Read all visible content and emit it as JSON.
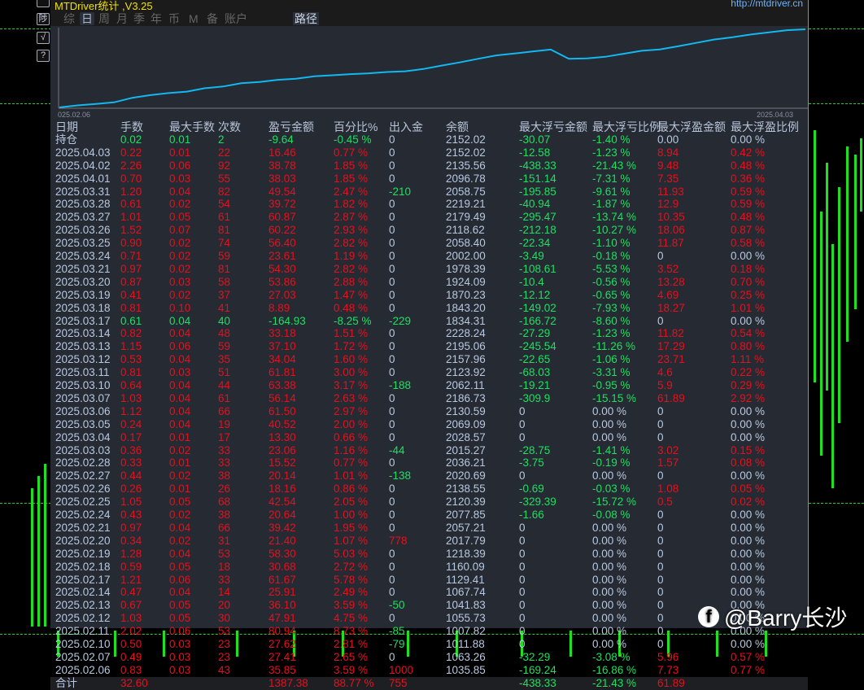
{
  "window": {
    "title": "MTDriver统计 ,V3.25",
    "url": "http://mtdriver.cn"
  },
  "toolbar": {
    "buttons": [
      "",
      "陟",
      "√",
      "?"
    ]
  },
  "tabs": [
    {
      "label": "综"
    },
    {
      "label": "日",
      "active": true
    },
    {
      "label": "周"
    },
    {
      "label": "月"
    },
    {
      "label": "季"
    },
    {
      "label": "年"
    },
    {
      "label": "币"
    },
    {
      "label": "M"
    },
    {
      "label": "备"
    },
    {
      "label": "账户"
    },
    {
      "label": "路径"
    }
  ],
  "chart_data": {
    "type": "line",
    "x_start_label": "025.02.06",
    "x_end_label": "2025.04.03",
    "series": "cumulative profit from table rows",
    "color": "#12b8f0"
  },
  "table": {
    "headers": [
      "日期",
      "手数",
      "最大手数",
      "次数",
      "盈亏金额",
      "百分比%",
      "出入金",
      "余额",
      "最大浮亏金额",
      "最大浮亏比例",
      "最大浮盈金额",
      "最大浮盈比例"
    ],
    "holding": [
      "持仓",
      "0.02",
      "0.01",
      "2",
      "-9.64",
      "-0.45 %",
      "0",
      "2152.02",
      "-30.07",
      "-1.40 %",
      "0.00",
      "0.00 %"
    ],
    "rows": [
      [
        "2025.04.03",
        "0.22",
        "0.01",
        "22",
        "16.46",
        "0.77 %",
        "0",
        "2152.02",
        "-12.58",
        "-1.23 %",
        "8.94",
        "0.42 %"
      ],
      [
        "2025.04.02",
        "2.26",
        "0.06",
        "92",
        "38.78",
        "1.85 %",
        "0",
        "2135.56",
        "-438.33",
        "-21.43 %",
        "9.48",
        "0.48 %"
      ],
      [
        "2025.04.01",
        "0.70",
        "0.03",
        "55",
        "38.03",
        "1.85 %",
        "0",
        "2096.78",
        "-151.14",
        "-7.31 %",
        "7.35",
        "0.36 %"
      ],
      [
        "2025.03.31",
        "1.20",
        "0.04",
        "82",
        "49.54",
        "2.47 %",
        "-210",
        "2058.75",
        "-195.85",
        "-9.61 %",
        "11.93",
        "0.59 %"
      ],
      [
        "2025.03.28",
        "0.61",
        "0.02",
        "54",
        "39.72",
        "1.82 %",
        "0",
        "2219.21",
        "-40.94",
        "-1.87 %",
        "12.9",
        "0.59 %"
      ],
      [
        "2025.03.27",
        "1.01",
        "0.05",
        "61",
        "60.87",
        "2.87 %",
        "0",
        "2179.49",
        "-295.47",
        "-13.74 %",
        "10.35",
        "0.48 %"
      ],
      [
        "2025.03.26",
        "1.52",
        "0.07",
        "81",
        "60.22",
        "2.93 %",
        "0",
        "2118.62",
        "-212.18",
        "-10.27 %",
        "18.06",
        "0.87 %"
      ],
      [
        "2025.03.25",
        "0.90",
        "0.02",
        "74",
        "56.40",
        "2.82 %",
        "0",
        "2058.40",
        "-22.34",
        "-1.10 %",
        "11.87",
        "0.58 %"
      ],
      [
        "2025.03.24",
        "0.71",
        "0.02",
        "59",
        "23.61",
        "1.19 %",
        "0",
        "2002.00",
        "-3.49",
        "-0.18 %",
        "0",
        "0.00 %"
      ],
      [
        "2025.03.21",
        "0.97",
        "0.02",
        "81",
        "54.30",
        "2.82 %",
        "0",
        "1978.39",
        "-108.61",
        "-5.53 %",
        "3.52",
        "0.18 %"
      ],
      [
        "2025.03.20",
        "0.87",
        "0.03",
        "58",
        "53.86",
        "2.88 %",
        "0",
        "1924.09",
        "-10.4",
        "-0.56 %",
        "13.28",
        "0.70 %"
      ],
      [
        "2025.03.19",
        "0.41",
        "0.02",
        "37",
        "27.03",
        "1.47 %",
        "0",
        "1870.23",
        "-12.12",
        "-0.65 %",
        "4.69",
        "0.25 %"
      ],
      [
        "2025.03.18",
        "0.81",
        "0.10",
        "41",
        "8.89",
        "0.48 %",
        "0",
        "1843.20",
        "-149.02",
        "-7.93 %",
        "18.27",
        "1.01 %"
      ],
      [
        "2025.03.17",
        "0.61",
        "0.04",
        "40",
        "-164.93",
        "-8.25 %",
        "-229",
        "1834.31",
        "-166.72",
        "-8.60 %",
        "0",
        "0.00 %"
      ],
      [
        "2025.03.14",
        "0.82",
        "0.04",
        "48",
        "33.18",
        "1.51 %",
        "0",
        "2228.24",
        "-27.29",
        "-1.23 %",
        "11.82",
        "0.54 %"
      ],
      [
        "2025.03.13",
        "1.15",
        "0.06",
        "59",
        "37.10",
        "1.72 %",
        "0",
        "2195.06",
        "-245.54",
        "-11.26 %",
        "17.29",
        "0.80 %"
      ],
      [
        "2025.03.12",
        "0.53",
        "0.04",
        "35",
        "34.04",
        "1.60 %",
        "0",
        "2157.96",
        "-22.65",
        "-1.06 %",
        "23.71",
        "1.11 %"
      ],
      [
        "2025.03.11",
        "0.81",
        "0.03",
        "51",
        "61.81",
        "3.00 %",
        "0",
        "2123.92",
        "-68.03",
        "-3.31 %",
        "4.6",
        "0.22 %"
      ],
      [
        "2025.03.10",
        "0.64",
        "0.04",
        "44",
        "63.38",
        "3.17 %",
        "-188",
        "2062.11",
        "-19.21",
        "-0.95 %",
        "5.9",
        "0.29 %"
      ],
      [
        "2025.03.07",
        "1.03",
        "0.04",
        "61",
        "56.14",
        "2.63 %",
        "0",
        "2186.73",
        "-309.9",
        "-15.15 %",
        "61.89",
        "2.92 %"
      ],
      [
        "2025.03.06",
        "1.12",
        "0.04",
        "66",
        "61.50",
        "2.97 %",
        "0",
        "2130.59",
        "0",
        "0.00 %",
        "0",
        "0.00 %"
      ],
      [
        "2025.03.05",
        "0.24",
        "0.04",
        "19",
        "40.52",
        "2.00 %",
        "0",
        "2069.09",
        "0",
        "0.00 %",
        "0",
        "0.00 %"
      ],
      [
        "2025.03.04",
        "0.17",
        "0.01",
        "17",
        "13.30",
        "0.66 %",
        "0",
        "2028.57",
        "0",
        "0.00 %",
        "0",
        "0.00 %"
      ],
      [
        "2025.03.03",
        "0.36",
        "0.02",
        "33",
        "23.06",
        "1.16 %",
        "-44",
        "2015.27",
        "-28.75",
        "-1.41 %",
        "3.02",
        "0.15 %"
      ],
      [
        "2025.02.28",
        "0.33",
        "0.01",
        "33",
        "15.52",
        "0.77 %",
        "0",
        "2036.21",
        "-3.75",
        "-0.19 %",
        "1.57",
        "0.08 %"
      ],
      [
        "2025.02.27",
        "0.44",
        "0.02",
        "38",
        "20.14",
        "1.01 %",
        "-138",
        "2020.69",
        "0",
        "0.00 %",
        "0",
        "0.00 %"
      ],
      [
        "2025.02.26",
        "0.26",
        "0.01",
        "26",
        "18.16",
        "0.86 %",
        "0",
        "2138.55",
        "-0.69",
        "-0.03 %",
        "1.08",
        "0.05 %"
      ],
      [
        "2025.02.25",
        "1.05",
        "0.05",
        "68",
        "42.54",
        "2.05 %",
        "0",
        "2120.39",
        "-329.39",
        "-15.72 %",
        "0.5",
        "0.02 %"
      ],
      [
        "2025.02.24",
        "0.43",
        "0.02",
        "38",
        "20.64",
        "1.00 %",
        "0",
        "2077.85",
        "-1.66",
        "-0.08 %",
        "0",
        "0.00 %"
      ],
      [
        "2025.02.21",
        "0.97",
        "0.04",
        "66",
        "39.42",
        "1.95 %",
        "0",
        "2057.21",
        "0",
        "0.00 %",
        "0",
        "0.00 %"
      ],
      [
        "2025.02.20",
        "0.34",
        "0.02",
        "31",
        "21.40",
        "1.07 %",
        "778",
        "2017.79",
        "0",
        "0.00 %",
        "0",
        "0.00 %"
      ],
      [
        "2025.02.19",
        "1.28",
        "0.04",
        "53",
        "58.30",
        "5.03 %",
        "0",
        "1218.39",
        "0",
        "0.00 %",
        "0",
        "0.00 %"
      ],
      [
        "2025.02.18",
        "0.59",
        "0.05",
        "18",
        "30.68",
        "2.72 %",
        "0",
        "1160.09",
        "0",
        "0.00 %",
        "0",
        "0.00 %"
      ],
      [
        "2025.02.17",
        "1.21",
        "0.06",
        "33",
        "61.67",
        "5.78 %",
        "0",
        "1129.41",
        "0",
        "0.00 %",
        "0",
        "0.00 %"
      ],
      [
        "2025.02.14",
        "0.47",
        "0.04",
        "14",
        "25.91",
        "2.49 %",
        "0",
        "1067.74",
        "0",
        "0.00 %",
        "0",
        "0.00 %"
      ],
      [
        "2025.02.13",
        "0.67",
        "0.05",
        "20",
        "36.10",
        "3.59 %",
        "-50",
        "1041.83",
        "0",
        "0.00 %",
        "0",
        "0.00 %"
      ],
      [
        "2025.02.12",
        "1.03",
        "0.05",
        "30",
        "47.91",
        "4.75 %",
        "0",
        "1055.73",
        "0",
        "0.00 %",
        "0",
        "0.00 %"
      ],
      [
        "2025.02.11",
        "2.02",
        "0.06",
        "53",
        "80.94",
        "8.73 %",
        "-85",
        "1007.82",
        "0",
        "0.00 %",
        "0",
        "0.00 %"
      ],
      [
        "2025.02.10",
        "0.50",
        "0.03",
        "23",
        "27.62",
        "2.81 %",
        "-79",
        "1011.88",
        "0",
        "0.00 %",
        "0",
        "0.00 %"
      ],
      [
        "2025.02.07",
        "0.49",
        "0.03",
        "23",
        "27.41",
        "2.65 %",
        "0",
        "1063.26",
        "-32.29",
        "-3.08 %",
        "5.96",
        "0.57 %"
      ],
      [
        "2025.02.06",
        "0.83",
        "0.03",
        "43",
        "35.85",
        "3.59 %",
        "1000",
        "1035.85",
        "-169.24",
        "-16.86 %",
        "7.73",
        "0.77 %"
      ]
    ],
    "total": [
      "合计",
      "32.60",
      "",
      "",
      "1387.38",
      "88.77 %",
      "755",
      "",
      "-438.33",
      "-21.43 %",
      "61.89",
      ""
    ]
  },
  "watermark": {
    "text": "@Barry长沙"
  },
  "colors": {
    "profit": "#e8101c",
    "loss": "#1ee060",
    "neutral": "#b8c8e0",
    "line": "#12b8f0"
  }
}
